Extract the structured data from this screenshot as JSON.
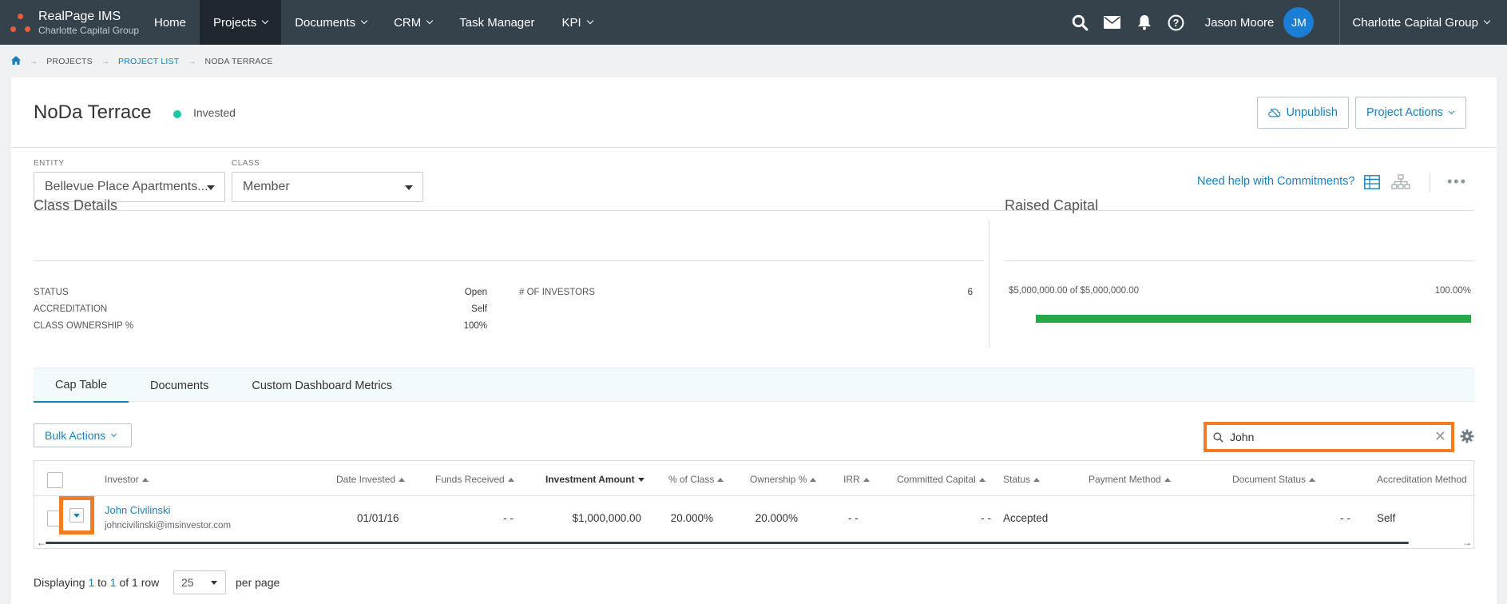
{
  "brand": {
    "title": "RealPage IMS",
    "subtitle": "Charlotte Capital Group"
  },
  "nav": {
    "items": [
      {
        "label": "Home"
      },
      {
        "label": "Projects"
      },
      {
        "label": "Documents"
      },
      {
        "label": "CRM"
      },
      {
        "label": "Task Manager"
      },
      {
        "label": "KPI"
      }
    ],
    "user_name": "Jason Moore",
    "user_initials": "JM",
    "org": "Charlotte Capital Group"
  },
  "breadcrumb": {
    "items": [
      "PROJECTS",
      "PROJECT LIST",
      "NODA TERRACE"
    ]
  },
  "header": {
    "title": "NoDa Terrace",
    "status": "Invested",
    "unpublish_label": "Unpublish",
    "project_actions_label": "Project Actions"
  },
  "filters": {
    "entity_label": "ENTITY",
    "entity_value": "Bellevue Place Apartments...",
    "class_label": "CLASS",
    "class_value": "Member",
    "help_link": "Need help with Commitments?"
  },
  "class_details": {
    "title": "Class Details",
    "rows": [
      {
        "label": "STATUS",
        "value": "Open"
      },
      {
        "label": "ACCREDITATION",
        "value": "Self"
      },
      {
        "label": "CLASS OWNERSHIP %",
        "value": "100%"
      }
    ],
    "investors_label": "# OF INVESTORS",
    "investors_value": "6"
  },
  "raised_capital": {
    "title": "Raised Capital",
    "amount_text": "$5,000,000.00 of $5,000,000.00",
    "percent_text": "100.00%",
    "progress_fraction": 1.0,
    "progress_color": "#27a745"
  },
  "tabs": [
    {
      "label": "Cap Table"
    },
    {
      "label": "Documents"
    },
    {
      "label": "Custom Dashboard Metrics"
    }
  ],
  "bulk_actions_label": "Bulk Actions",
  "search": {
    "value": "John"
  },
  "table": {
    "columns": [
      "Investor",
      "Date Invested",
      "Funds Received",
      "Investment Amount",
      "% of Class",
      "Ownership %",
      "IRR",
      "Committed Capital",
      "Status",
      "Payment Method",
      "Document Status",
      "Accreditation Method"
    ],
    "rows": [
      {
        "name": "John Civilinski",
        "email": "johncivilinski@imsinvestor.com",
        "date_invested": "01/01/16",
        "funds_received": "- -",
        "investment_amount": "$1,000,000.00",
        "pct_class": "20.000%",
        "ownership": "20.000%",
        "irr": "- -",
        "committed_capital": "- -",
        "status": "Accepted",
        "payment_method": "",
        "document_status": "- -",
        "accreditation": "Self"
      }
    ]
  },
  "footer": {
    "prefix": "Displaying",
    "from": "1",
    "to_word": "to",
    "to": "1",
    "of_word": "of",
    "total": "1",
    "row_word": "row",
    "per_page_value": "25",
    "per_page_label": "per page"
  },
  "colors": {
    "nav_bg": "#36424b",
    "accent": "#1a7fb8",
    "highlight": "#f37b22",
    "status_dot": "#1cc7a8"
  }
}
